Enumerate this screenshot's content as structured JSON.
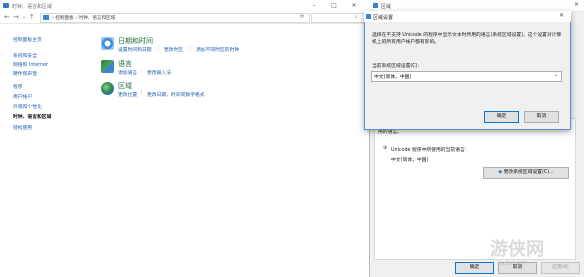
{
  "control_panel": {
    "title": "时钟、语言和区域",
    "breadcrumb": [
      "控制面板",
      "时钟、语言和区域"
    ],
    "sidebar": {
      "items": [
        {
          "label": "控制面板主页",
          "current": false
        },
        {
          "label": "系统和安全",
          "current": false
        },
        {
          "label": "网络和 Internet",
          "current": false
        },
        {
          "label": "硬件和声音",
          "current": false
        },
        {
          "label": "程序",
          "current": false
        },
        {
          "label": "用户帐户",
          "current": false
        },
        {
          "label": "外观和个性化",
          "current": false
        },
        {
          "label": "时钟、语言和区域",
          "current": true
        },
        {
          "label": "轻松使用",
          "current": false
        }
      ]
    },
    "categories": [
      {
        "title": "日期和时间",
        "icon": "clock-icon",
        "links": [
          "设置时间和日期",
          "更改时区",
          "添加不同时区的时钟"
        ]
      },
      {
        "title": "语言",
        "icon": "language-icon",
        "links": [
          "添加语言",
          "更改输入法"
        ]
      },
      {
        "title": "区域",
        "icon": "globe-icon",
        "links": [
          "更改位置",
          "更改日期、时间或数字格式"
        ]
      }
    ]
  },
  "region_dialog": {
    "title": "区域",
    "partial_text": "用的语言。",
    "unicode_label": "Unicode 程序中所使用的当前语言:",
    "unicode_value": "中文(简体，中国)",
    "change_button": "更改系统区域设置(C)...",
    "ok": "确定",
    "cancel": "取消",
    "apply": "应用(A)"
  },
  "settings_dialog": {
    "title": "区域设置",
    "description": "选择在不支持 Unicode 的程序中显示文本时所用的语言(系统区域设置)。这个设置对计算机上的所有用户帐户都有影响。",
    "label": "当前系统区域设置(C):",
    "selected": "中文(简体，中国)",
    "ok": "确定",
    "cancel": "取消"
  },
  "watermark": {
    "text": "游侠网",
    "site": "ALI213.NET"
  }
}
